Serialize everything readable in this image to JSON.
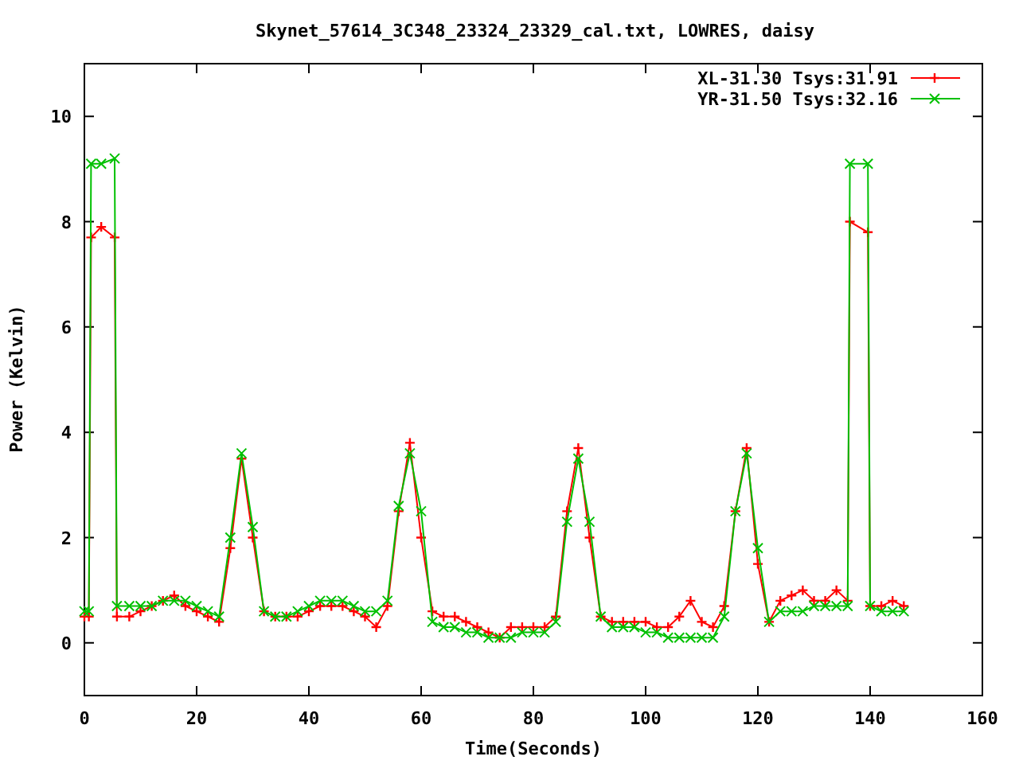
{
  "plot": {
    "chart_data": {
      "type": "line",
      "title": "Skynet_57614_3C348_23324_23329_cal.txt, LOWRES, daisy",
      "xlabel": "Time(Seconds)",
      "ylabel": "Power (Kelvin)",
      "xlim": [
        0,
        160
      ],
      "ylim": [
        -1,
        11
      ],
      "xticks": [
        0,
        20,
        40,
        60,
        80,
        100,
        120,
        140,
        160
      ],
      "yticks": [
        0,
        2,
        4,
        6,
        8,
        10
      ],
      "legend": "top-right",
      "x": [
        0,
        0.8,
        1.2,
        3,
        5.4,
        5.8,
        8,
        10,
        12,
        14,
        16,
        18,
        20,
        22,
        24,
        26,
        28,
        30,
        32,
        34,
        36,
        38,
        40,
        42,
        44,
        46,
        48,
        50,
        52,
        54,
        56,
        58,
        60,
        62,
        64,
        66,
        68,
        70,
        72,
        74,
        76,
        78,
        80,
        82,
        84,
        86,
        88,
        90,
        92,
        94,
        96,
        98,
        100,
        102,
        104,
        106,
        108,
        110,
        112,
        114,
        116,
        118,
        120,
        122,
        124,
        126,
        128,
        130,
        132,
        134,
        136,
        136.4,
        139.6,
        140,
        142,
        144,
        146
      ],
      "series": [
        {
          "name": "XL-31.30 Tsys:31.91",
          "color": "#ff0000",
          "marker": "+",
          "values": [
            0.5,
            0.5,
            7.7,
            7.9,
            7.7,
            0.5,
            0.5,
            0.6,
            0.7,
            0.8,
            0.9,
            0.7,
            0.6,
            0.5,
            0.4,
            1.8,
            3.5,
            2.0,
            0.6,
            0.5,
            0.5,
            0.5,
            0.6,
            0.7,
            0.7,
            0.7,
            0.6,
            0.5,
            0.3,
            0.7,
            2.5,
            3.8,
            2.0,
            0.6,
            0.5,
            0.5,
            0.4,
            0.3,
            0.2,
            0.1,
            0.3,
            0.3,
            0.3,
            0.3,
            0.5,
            2.5,
            3.7,
            2.0,
            0.5,
            0.4,
            0.4,
            0.4,
            0.4,
            0.3,
            0.3,
            0.5,
            0.8,
            0.4,
            0.3,
            0.7,
            2.5,
            3.7,
            1.5,
            0.4,
            0.8,
            0.9,
            1.0,
            0.8,
            0.8,
            1.0,
            0.8,
            8.0,
            7.8,
            0.7,
            0.7,
            0.8,
            0.7
          ]
        },
        {
          "name": "YR-31.50 Tsys:32.16",
          "color": "#00c000",
          "marker": "x",
          "values": [
            0.6,
            0.6,
            9.1,
            9.1,
            9.2,
            0.7,
            0.7,
            0.7,
            0.7,
            0.8,
            0.8,
            0.8,
            0.7,
            0.6,
            0.5,
            2.0,
            3.6,
            2.2,
            0.6,
            0.5,
            0.5,
            0.6,
            0.7,
            0.8,
            0.8,
            0.8,
            0.7,
            0.6,
            0.6,
            0.8,
            2.6,
            3.6,
            2.5,
            0.4,
            0.3,
            0.3,
            0.2,
            0.2,
            0.1,
            0.1,
            0.1,
            0.2,
            0.2,
            0.2,
            0.4,
            2.3,
            3.5,
            2.3,
            0.5,
            0.3,
            0.3,
            0.3,
            0.2,
            0.2,
            0.1,
            0.1,
            0.1,
            0.1,
            0.1,
            0.5,
            2.5,
            3.6,
            1.8,
            0.4,
            0.6,
            0.6,
            0.6,
            0.7,
            0.7,
            0.7,
            0.7,
            9.1,
            9.1,
            0.7,
            0.6,
            0.6,
            0.6
          ]
        }
      ]
    }
  }
}
